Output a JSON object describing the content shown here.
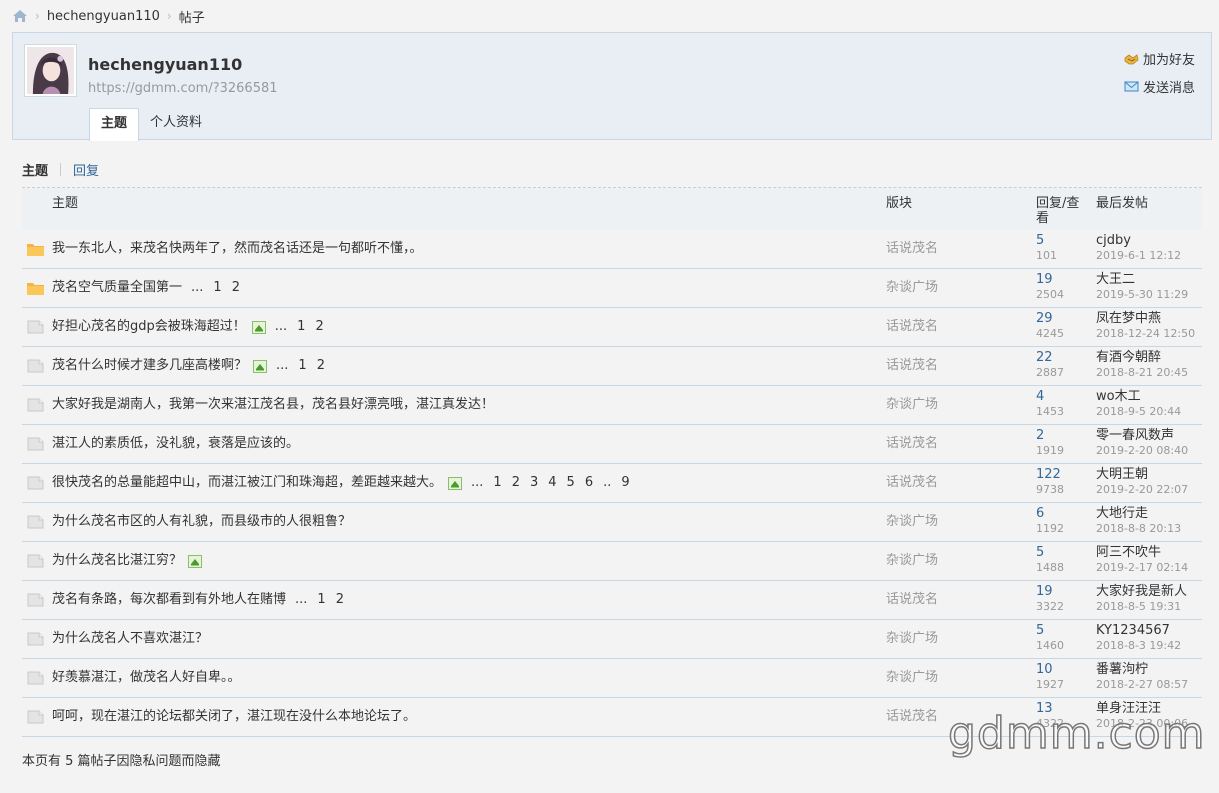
{
  "breadcrumb": {
    "user": "hechengyuan110",
    "page": "帖子"
  },
  "profile": {
    "username": "hechengyuan110",
    "url": "https://gdmm.com/?3266581",
    "actions": {
      "add_friend": "加为好友",
      "send_message": "发送消息"
    },
    "tabs": [
      "主题",
      "个人资料"
    ]
  },
  "subtabs": {
    "topics": "主题",
    "replies": "回复"
  },
  "table": {
    "headers": {
      "topic": "主题",
      "forum": "版块",
      "replies_views": "回复/查看",
      "last_post": "最后发帖"
    },
    "rows": [
      {
        "icon": "folder",
        "title": "我一东北人，来茂名快两年了，然而茂名话还是一句都听不懂，。",
        "has_image": false,
        "pages": [],
        "forum": "话说茂名",
        "replies": "5",
        "views": "101",
        "last_user": "cjdby",
        "last_time": "2019-6-1 12:12"
      },
      {
        "icon": "folder",
        "title": "茂名空气质量全国第一",
        "has_image": false,
        "pages": [
          "...",
          "1",
          "2"
        ],
        "forum": "杂谈广场",
        "replies": "19",
        "views": "2504",
        "last_user": "大王二",
        "last_time": "2019-5-30 11:29"
      },
      {
        "icon": "doc",
        "title": "好担心茂名的gdp会被珠海超过！",
        "has_image": true,
        "pages": [
          "...",
          "1",
          "2"
        ],
        "forum": "话说茂名",
        "replies": "29",
        "views": "4245",
        "last_user": "凤在梦中燕",
        "last_time": "2018-12-24 12:50"
      },
      {
        "icon": "doc",
        "title": "茂名什么时候才建多几座高楼啊？",
        "has_image": true,
        "pages": [
          "...",
          "1",
          "2"
        ],
        "forum": "话说茂名",
        "replies": "22",
        "views": "2887",
        "last_user": "有酒今朝醉",
        "last_time": "2018-8-21 20:45"
      },
      {
        "icon": "doc",
        "title": "大家好我是湖南人，我第一次来湛江茂名县，茂名县好漂亮哦，湛江真发达！",
        "has_image": false,
        "pages": [],
        "forum": "杂谈广场",
        "replies": "4",
        "views": "1453",
        "last_user": "wo木工",
        "last_time": "2018-9-5 20:44"
      },
      {
        "icon": "doc",
        "title": "湛江人的素质低，没礼貌，衰落是应该的。",
        "has_image": false,
        "pages": [],
        "forum": "话说茂名",
        "replies": "2",
        "views": "1919",
        "last_user": "零一春风数声",
        "last_time": "2019-2-20 08:40"
      },
      {
        "icon": "doc",
        "title": "很快茂名的总量能超中山，而湛江被江门和珠海超，差距越来越大。",
        "has_image": true,
        "pages": [
          "...",
          "1",
          "2",
          "3",
          "4",
          "5",
          "6",
          "..",
          "9"
        ],
        "forum": "话说茂名",
        "replies": "122",
        "views": "9738",
        "last_user": "大明王朝",
        "last_time": "2019-2-20 22:07"
      },
      {
        "icon": "doc",
        "title": "为什么茂名市区的人有礼貌，而县级市的人很粗鲁？",
        "has_image": false,
        "pages": [],
        "forum": "杂谈广场",
        "replies": "6",
        "views": "1192",
        "last_user": "大地行走",
        "last_time": "2018-8-8 20:13"
      },
      {
        "icon": "doc",
        "title": "为什么茂名比湛江穷？",
        "has_image": true,
        "pages": [],
        "forum": "杂谈广场",
        "replies": "5",
        "views": "1488",
        "last_user": "阿三不吹牛",
        "last_time": "2019-2-17 02:14"
      },
      {
        "icon": "doc",
        "title": "茂名有条路，每次都看到有外地人在赌博",
        "has_image": false,
        "pages": [
          "...",
          "1",
          "2"
        ],
        "forum": "话说茂名",
        "replies": "19",
        "views": "3322",
        "last_user": "大家好我是新人",
        "last_time": "2018-8-5 19:31"
      },
      {
        "icon": "doc",
        "title": "为什么茂名人不喜欢湛江？",
        "has_image": false,
        "pages": [],
        "forum": "杂谈广场",
        "replies": "5",
        "views": "1460",
        "last_user": "KY1234567",
        "last_time": "2018-8-3 19:42"
      },
      {
        "icon": "doc",
        "title": "好羡慕湛江，做茂名人好自卑。。",
        "has_image": false,
        "pages": [],
        "forum": "杂谈广场",
        "replies": "10",
        "views": "1927",
        "last_user": "番薯泃柠",
        "last_time": "2018-2-27 08:57"
      },
      {
        "icon": "doc",
        "title": "呵呵，现在湛江的论坛都关闭了，湛江现在没什么本地论坛了。",
        "has_image": false,
        "pages": [],
        "forum": "话说茂名",
        "replies": "13",
        "views": "4322",
        "last_user": "单身汪汪汪",
        "last_time": "2018-2-23 00:06"
      }
    ]
  },
  "footer": "本页有 5 篇帖子因隐私问题而隐藏",
  "watermark": "gdmm.com",
  "colors": {
    "link": "#336699",
    "header_bg": "#e8eef4",
    "border": "#c8d7e4",
    "folder": "#f5b342"
  }
}
